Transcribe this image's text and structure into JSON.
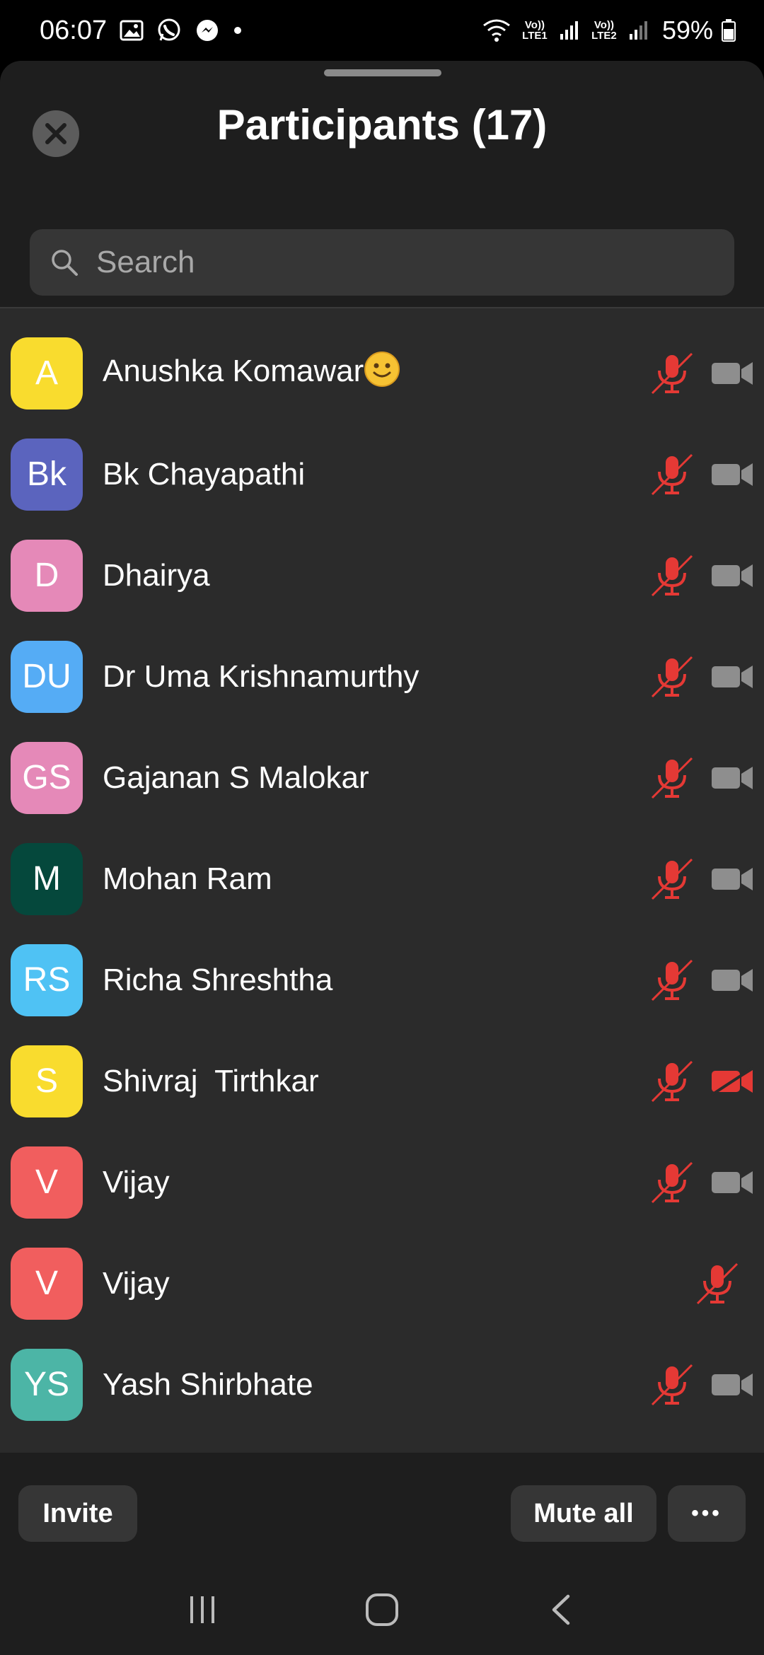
{
  "status": {
    "time": "06:07",
    "net1": "Vo)) LTE1",
    "net2": "Vo)) LTE2",
    "battery": "59%"
  },
  "header": {
    "title": "Participants (17)"
  },
  "search": {
    "placeholder": "Search"
  },
  "participants": [
    {
      "initials": "A",
      "name": "Anushka Komawar",
      "color": "#F9DC2E",
      "mic": "muted",
      "video": "off-gray",
      "emoji": "slightly-smiling-face"
    },
    {
      "initials": "Bk",
      "name": "Bk Chayapathi",
      "color": "#5B64BE",
      "mic": "muted",
      "video": "off-gray"
    },
    {
      "initials": "D",
      "name": "Dhairya",
      "color": "#E589B8",
      "mic": "muted",
      "video": "off-gray"
    },
    {
      "initials": "DU",
      "name": "Dr Uma Krishnamurthy",
      "color": "#55ACF5",
      "mic": "muted",
      "video": "off-gray"
    },
    {
      "initials": "GS",
      "name": "Gajanan S Malokar",
      "color": "#E589B8",
      "mic": "muted",
      "video": "off-gray"
    },
    {
      "initials": "M",
      "name": "Mohan Ram",
      "color": "#05483C",
      "mic": "muted",
      "video": "off-gray"
    },
    {
      "initials": "RS",
      "name": "Richa Shreshtha",
      "color": "#4FC2F4",
      "mic": "muted",
      "video": "off-gray"
    },
    {
      "initials": "S",
      "name": "Shivraj  Tirthkar",
      "color": "#F9DC2E",
      "mic": "muted",
      "video": "off-red"
    },
    {
      "initials": "V",
      "name": "Vijay",
      "color": "#F15E5E",
      "mic": "muted",
      "video": "off-gray"
    },
    {
      "initials": "V",
      "name": "Vijay",
      "color": "#F15E5E",
      "mic": "muted",
      "video": "none"
    },
    {
      "initials": "YS",
      "name": "Yash Shirbhate",
      "color": "#4CB5A6",
      "mic": "muted",
      "video": "off-gray"
    }
  ],
  "footer": {
    "invite": "Invite",
    "mute_all": "Mute all",
    "more": "•••"
  },
  "colors": {
    "muted_red": "#E53935",
    "icon_gray": "#8E8E8E",
    "sheet_bg": "#1E1E1E",
    "list_bg": "#2B2B2B"
  }
}
